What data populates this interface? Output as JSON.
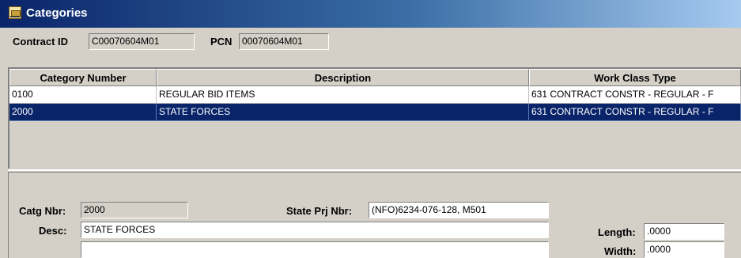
{
  "window": {
    "title": "Categories",
    "icon": "bulldozer-icon"
  },
  "header": {
    "contract_id_label": "Contract ID",
    "contract_id_value": "C00070604M01",
    "pcn_label": "PCN",
    "pcn_value": "00070604M01"
  },
  "grid": {
    "columns": [
      "Category Number",
      "Description",
      "Work Class Type"
    ],
    "rows": [
      {
        "category_number": "0100",
        "description": "REGULAR BID ITEMS",
        "work_class_type": "631 CONTRACT CONSTR - REGULAR - F",
        "selected": false
      },
      {
        "category_number": "2000",
        "description": "STATE FORCES",
        "work_class_type": "631 CONTRACT CONSTR - REGULAR - F",
        "selected": true
      }
    ]
  },
  "detail": {
    "catg_nbr_label": "Catg Nbr:",
    "catg_nbr_value": "2000",
    "state_prj_nbr_label": "State Prj Nbr:",
    "state_prj_nbr_value": "(NFO)6234-076-128, M501",
    "desc_label": "Desc:",
    "desc_value": "STATE FORCES",
    "desc_line2_value": "",
    "length_label": "Length:",
    "length_value": ".0000",
    "width_label": "Width:",
    "width_value": ".0000"
  },
  "colors": {
    "selection": "#0a246a",
    "title_gradient_start": "#0a246a",
    "title_gradient_end": "#a6caf0",
    "face": "#d4d0c8"
  }
}
